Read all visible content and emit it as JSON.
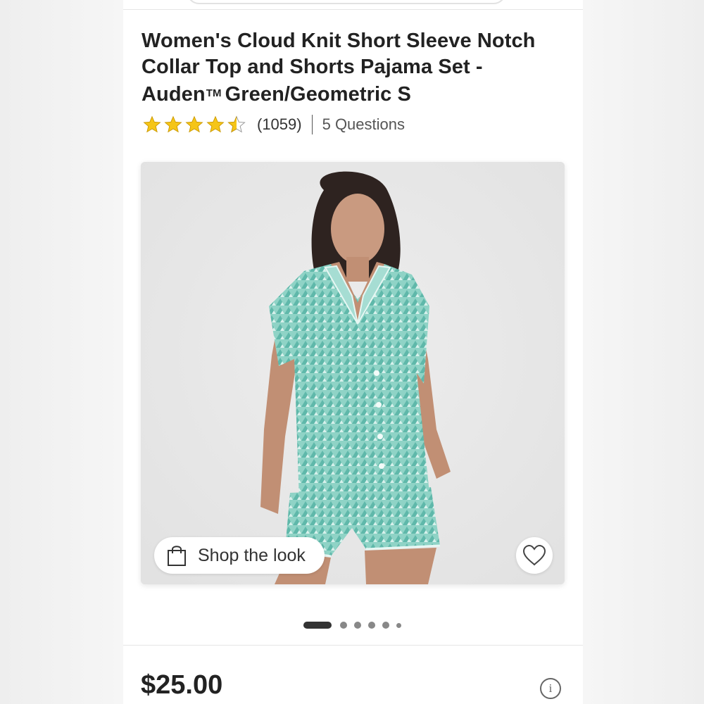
{
  "product": {
    "title_main": "Women's Cloud Knit Short Sleeve Notch Collar Top and Shorts Pajama Set - Auden",
    "title_tm": "TM",
    "title_variant": "Green/Geometric S",
    "rating": 4.5,
    "rating_max": 5,
    "review_count": "(1059)",
    "questions": "5 Questions",
    "price": "$25.00"
  },
  "image": {
    "shop_the_look_label": "Shop the look",
    "carousel_dot_count": 6,
    "active_dot_index": 0
  },
  "icons": {
    "star": "star-icon",
    "bag": "shopping-bag-icon",
    "favorite": "heart-icon",
    "info": "info-icon"
  },
  "colors": {
    "star_fill": "#f5c518",
    "text_primary": "#222222",
    "pajama_mint": "#86cfc2"
  }
}
